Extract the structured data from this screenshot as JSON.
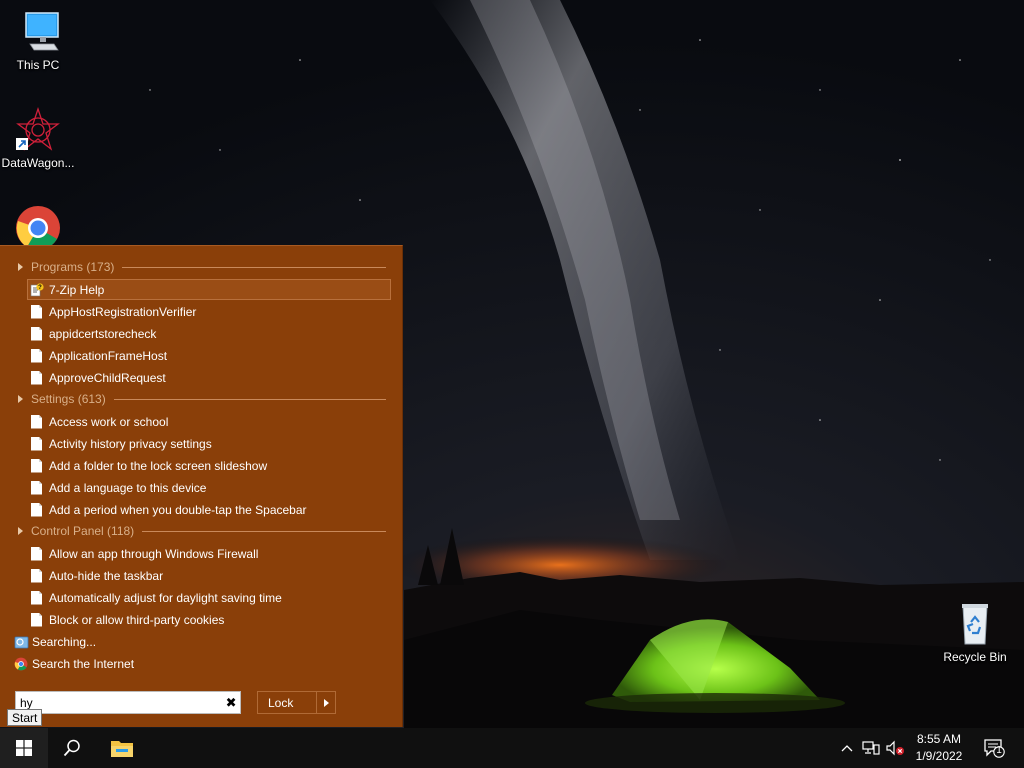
{
  "desktop": {
    "icons": [
      {
        "label": "This PC",
        "icon": "this-pc-icon"
      },
      {
        "label": "DataWagon...",
        "icon": "datawagon-icon"
      },
      {
        "label": "",
        "icon": "chrome-icon"
      },
      {
        "label": "Recycle Bin",
        "icon": "recycle-bin-icon"
      }
    ]
  },
  "start_menu": {
    "groups": [
      {
        "header": "Programs (173)",
        "items": [
          "7-Zip Help",
          "AppHostRegistrationVerifier",
          "appidcertstorecheck",
          "ApplicationFrameHost",
          "ApproveChildRequest"
        ]
      },
      {
        "header": "Settings (613)",
        "items": [
          "Access work or school",
          "Activity history privacy settings",
          "Add a folder to the lock screen slideshow",
          "Add a language to this device",
          "Add a period when you double-tap the Spacebar"
        ]
      },
      {
        "header": "Control Panel (118)",
        "items": [
          "Allow an app through Windows Firewall",
          "Auto-hide the taskbar",
          "Automatically adjust for daylight saving time",
          "Block or allow third-party cookies"
        ]
      }
    ],
    "selected_item": "7-Zip Help",
    "searching_label": "Searching...",
    "search_internet_label": "Search the Internet",
    "search": {
      "value": "hy",
      "placeholder": ""
    },
    "lock_label": "Lock",
    "tooltip": "Start"
  },
  "taskbar": {
    "time": "8:55 AM",
    "date": "1/9/2022",
    "notification_count": "1",
    "icons": [
      "windows-start-icon",
      "search-icon",
      "file-explorer-icon",
      "chevron-up-icon",
      "network-icon",
      "volume-muted-icon",
      "action-center-icon"
    ]
  },
  "colors": {
    "menu_background": "#8a3f09",
    "menu_header_text": "#d9b08a",
    "taskbar": "#101010",
    "tent_green": "#7ed321"
  }
}
